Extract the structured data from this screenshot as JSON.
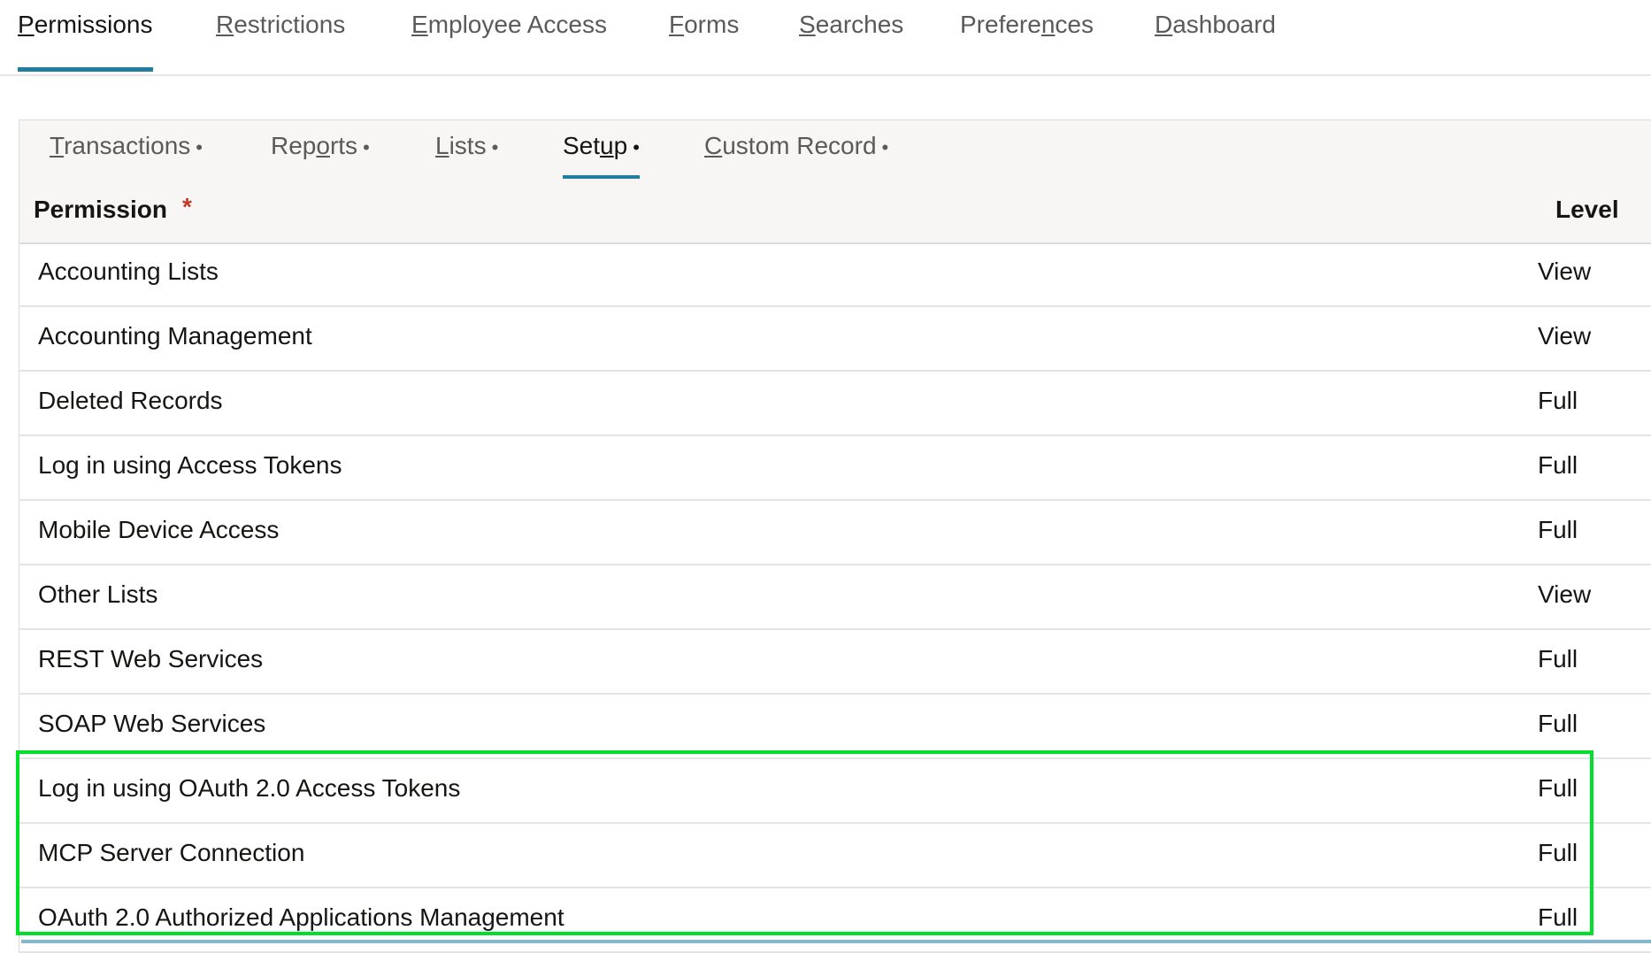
{
  "top_tabs": [
    {
      "pre": "",
      "u": "P",
      "post": "ermissions",
      "active": true
    },
    {
      "pre": "",
      "u": "R",
      "post": "estrictions",
      "active": false
    },
    {
      "pre": "",
      "u": "E",
      "post": "mployee Access",
      "active": false
    },
    {
      "pre": "",
      "u": "F",
      "post": "orms",
      "active": false
    },
    {
      "pre": "",
      "u": "S",
      "post": "earches",
      "active": false
    },
    {
      "pre": "Prefere",
      "u": "n",
      "post": "ces",
      "active": false
    },
    {
      "pre": "",
      "u": "D",
      "post": "ashboard",
      "active": false
    }
  ],
  "sub_tabs": [
    {
      "pre": "",
      "u": "T",
      "post": "ransactions",
      "dot": "•",
      "active": false
    },
    {
      "pre": "Rep",
      "u": "o",
      "post": "rts",
      "dot": "•",
      "active": false
    },
    {
      "pre": "",
      "u": "L",
      "post": "ists",
      "dot": "•",
      "active": false
    },
    {
      "pre": "Set",
      "u": "u",
      "post": "p",
      "dot": "•",
      "active": true
    },
    {
      "pre": "",
      "u": "C",
      "post": "ustom Record",
      "dot": "•",
      "active": false
    }
  ],
  "table": {
    "headers": {
      "permission": "Permission",
      "required_mark": "*",
      "level": "Level"
    },
    "rows": [
      {
        "permission": "Accounting Lists",
        "level": "View"
      },
      {
        "permission": "Accounting Management",
        "level": "View"
      },
      {
        "permission": "Deleted Records",
        "level": "Full"
      },
      {
        "permission": "Log in using Access Tokens",
        "level": "Full"
      },
      {
        "permission": "Mobile Device Access",
        "level": "Full"
      },
      {
        "permission": "Other Lists",
        "level": "View"
      },
      {
        "permission": "REST Web Services",
        "level": "Full"
      },
      {
        "permission": "SOAP Web Services",
        "level": "Full"
      },
      {
        "permission": "Log in using OAuth 2.0 Access Tokens",
        "level": "Full"
      },
      {
        "permission": "MCP Server Connection",
        "level": "Full"
      },
      {
        "permission": "OAuth 2.0 Authorized Applications Management",
        "level": "Full"
      }
    ]
  },
  "colors": {
    "accent": "#227e9e",
    "highlight_box": "#00e02a",
    "required_mark": "#c0392b"
  }
}
